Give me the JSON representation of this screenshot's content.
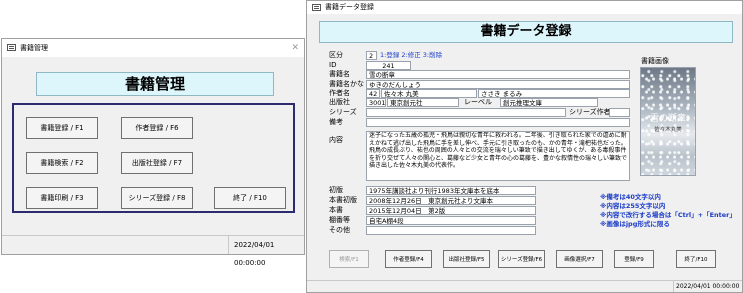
{
  "menu": {
    "title": "書籍管理",
    "banner": "書籍管理",
    "buttons": {
      "book_register": "書籍登録 / F1",
      "author_register": "作者登録 / F6",
      "book_search": "書籍検索 / F2",
      "publisher_register": "出版社登録 / F7",
      "book_print": "書籍印刷 / F3",
      "series_register": "シリーズ登録 / F8",
      "exit": "終了 / F10"
    },
    "status_time": "2022/04/01 00:00:00"
  },
  "entry": {
    "title": "書籍データ登録",
    "banner": "書籍データ登録",
    "labels": {
      "category": "区分",
      "id": "ID",
      "book_title": "書籍名",
      "title_kana": "書籍名かな",
      "author": "作者名",
      "publisher": "出版社",
      "series": "シリーズ",
      "remarks": "備考",
      "content": "内容",
      "first_edition": "初版",
      "this_edition": "本書初版",
      "this_book": "本書",
      "shelf": "棚番等",
      "other": "その他",
      "label_field": "レーベル",
      "series_author": "シリーズ作者",
      "book_image": "書籍画像"
    },
    "category_value": "2",
    "category_options": "1:登録  2:修正  3:削除",
    "id_value": "241",
    "book_title_value": "雪の断章",
    "title_kana_value": "ゆきのだんしょう",
    "author_id": "42",
    "author_name": "佐々木 丸美",
    "author_kana": "ささき まるみ",
    "publisher_id": "3001",
    "publisher_name": "東京創元社",
    "label_value": "創元推理文庫",
    "series_value": "",
    "series_author_value": "",
    "remarks_value": "",
    "content_value": "迷子になった五歳の孤児・飛鳥は親切な青年に救われる。二年後、引き取られた家での虐めに耐えかねて逃げ出した飛鳥に手を差し伸べ、手元に引き取ったのも、かの青年・滝杷祐也だった。飛鳥の成長ぶり、祐也の周囲の人々との交流を瑞々しい筆致で描き出してゆくが、ある毒殺事件を折り交ぜて人々の関心と、葛藤など少女と青年の心の葛藤を、豊かな叙情性の瑞々しい筆致で描き出した佐々木丸美の代表作。",
    "first_edition_value": "1975年講談社より刊行1983年文庫本を底本",
    "this_edition_value": "2008年12月26日　東京創元社より文庫本",
    "this_book_value": "2015年12月04日　第2版",
    "shelf_value": "自宅A棚4段",
    "other_value": "",
    "cover": {
      "title": "雪の断章",
      "author": "佐々木丸美"
    },
    "notes": [
      "※備考は40文字以内",
      "※内容は255文字以内",
      "※内容で改行する場合は「Ctrl」+「Enter」",
      "※画像はjpg形式に限る"
    ],
    "buttons": {
      "search": "検索/F1",
      "author_register": "作者登録/F4",
      "publisher_register": "出版社登録/F5",
      "series_register": "シリーズ登録/F6",
      "image_select": "画像選択/F7",
      "register": "登録/F9",
      "exit": "終了/F10"
    },
    "status_time": "2022/04/01 00:00:00"
  },
  "colors": {
    "banner_bg": "#ddf6fb",
    "window_bg": "#f0f0f0",
    "note_text": "#1a3bc8"
  }
}
